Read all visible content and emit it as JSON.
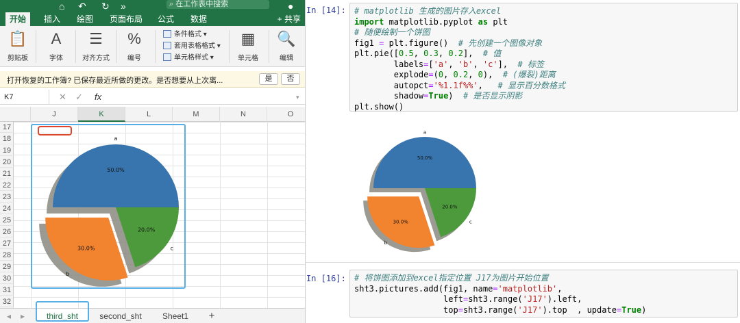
{
  "excel": {
    "search_placeholder": "在工作表中搜索",
    "ribbon_tabs": [
      "开始",
      "插入",
      "绘图",
      "页面布局",
      "公式",
      "数据"
    ],
    "share_label": "共享",
    "ribbon_groups": {
      "clipboard": "剪贴板",
      "font": "字体",
      "align": "对齐方式",
      "number": "编号",
      "cells": "单元格",
      "edit": "编辑"
    },
    "styles": [
      "条件格式",
      "套用表格格式",
      "单元格样式"
    ],
    "msg": {
      "text": "打开恢复的工作簿? 已保存最近所做的更改。是否想要从上次离...",
      "yes": "是",
      "no": "否"
    },
    "namebox": "K7",
    "fx": "fx",
    "columns": [
      "J",
      "K",
      "L",
      "M",
      "N",
      "O"
    ],
    "selected_column": "K",
    "rows": [
      "17",
      "18",
      "19",
      "20",
      "21",
      "22",
      "23",
      "24",
      "25",
      "26",
      "27",
      "28",
      "29",
      "30",
      "31",
      "32"
    ],
    "sheets": [
      "third_sht",
      "second_sht",
      "Sheet1"
    ],
    "add_sheet": "+"
  },
  "chart_data": {
    "type": "pie",
    "labels": [
      "a",
      "b",
      "c"
    ],
    "values": [
      0.5,
      0.3,
      0.2
    ],
    "percent_labels": [
      "50.0%",
      "30.0%",
      "20.0%"
    ],
    "explode": [
      0,
      0.2,
      0
    ],
    "shadow": true,
    "colors": [
      "#3874ad",
      "#f2832f",
      "#4d9a3c"
    ]
  },
  "notebook": {
    "cell1_prompt": "In [14]:",
    "cell2_prompt": "In [16]:"
  }
}
